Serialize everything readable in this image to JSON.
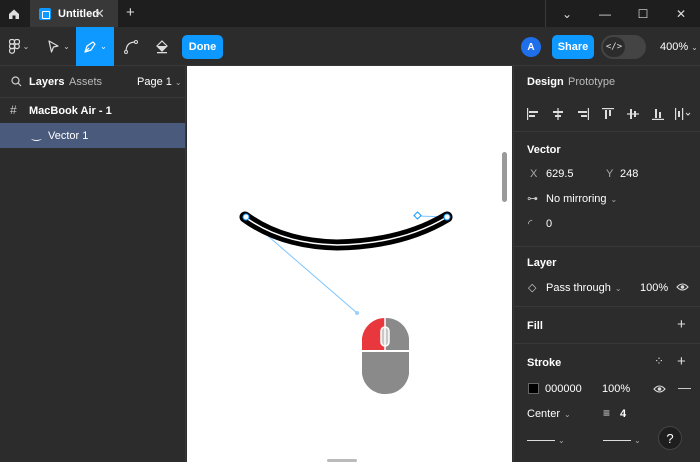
{
  "titlebar": {
    "tab_title": "Untitled",
    "tab_close": "✕",
    "new_tab": "+",
    "minimize": "—",
    "maximize": "☐",
    "close": "✕",
    "chevron": "⌄"
  },
  "toolbar": {
    "done_label": "Done",
    "avatar_initial": "A",
    "share_label": "Share",
    "dev_mode_glyph": "</>",
    "zoom": "400%"
  },
  "left_panel": {
    "layers_tab": "Layers",
    "assets_tab": "Assets",
    "page_selector": "Page 1",
    "frame_name": "MacBook Air - 1",
    "vector_name": "Vector 1"
  },
  "right_panel": {
    "design_tab": "Design",
    "prototype_tab": "Prototype",
    "vector": {
      "title": "Vector",
      "x_label": "X",
      "x_value": "629.5",
      "y_label": "Y",
      "y_value": "248",
      "mirroring": "No mirroring",
      "corner_radius": "0"
    },
    "layer": {
      "title": "Layer",
      "blend_mode": "Pass through",
      "opacity": "100%"
    },
    "fill": {
      "title": "Fill"
    },
    "stroke": {
      "title": "Stroke",
      "color_hex": "000000",
      "opacity": "100%",
      "position": "Center",
      "weight": "4"
    },
    "help": "?"
  },
  "colors": {
    "accent": "#0d99ff",
    "selection": "#4a5a7c",
    "stroke_swatch": "#000000",
    "mouse_left_button": "#e8383d",
    "mouse_body": "#8a8a8a"
  }
}
